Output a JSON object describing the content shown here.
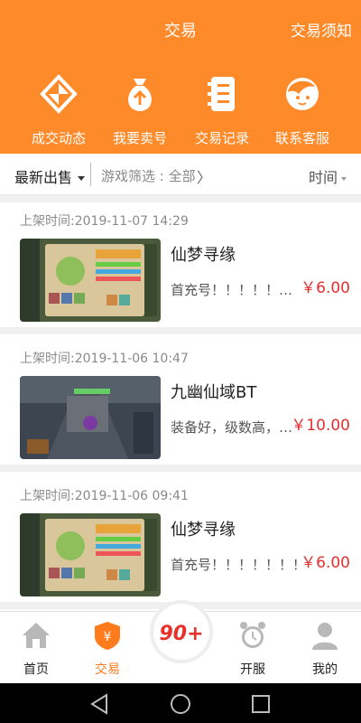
{
  "header": {
    "title": "交易",
    "notice_link": "交易须知",
    "bg_color": "#ff8a2a"
  },
  "quick_nav": [
    {
      "label": "成交动态",
      "icon": "deal-news-icon"
    },
    {
      "label": "我要卖号",
      "icon": "money-bag-icon"
    },
    {
      "label": "交易记录",
      "icon": "records-icon"
    },
    {
      "label": "联系客服",
      "icon": "customer-service-icon"
    }
  ],
  "filter": {
    "sort": "最新出售",
    "game_filter": "游戏筛选 : 全部",
    "time_sort": "时间"
  },
  "listings": [
    {
      "time": "上架时间:2019-11-07 14:29",
      "game": "仙梦寻缘",
      "desc": "首充号！！！！！！！！！",
      "price": "￥6.00"
    },
    {
      "time": "上架时间:2019-11-06 10:47",
      "game": "九幽仙域BT",
      "desc": "装备好，级数高，充值多",
      "price": "￥10.00"
    },
    {
      "time": "上架时间:2019-11-06 09:41",
      "game": "仙梦寻缘",
      "desc": "首充号！！！！！！！",
      "price": "￥6.00"
    }
  ],
  "tabbar": [
    {
      "label": "首页",
      "icon": "home-icon"
    },
    {
      "label": "交易",
      "icon": "trade-shield-icon",
      "active": true
    },
    {
      "label": "开服",
      "icon": "alarm-clock-icon"
    },
    {
      "label": "我的",
      "icon": "profile-icon"
    }
  ],
  "center_logo_text": "90+",
  "accent_color": "#ff7b1c",
  "price_color": "#e62e2e"
}
